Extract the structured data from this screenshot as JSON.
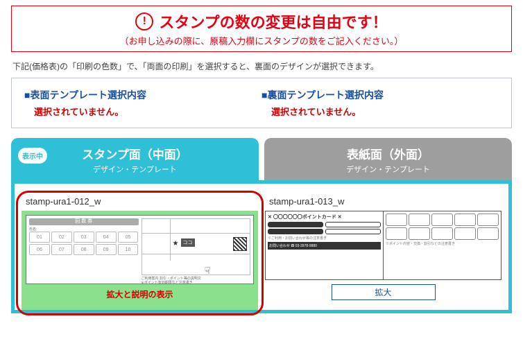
{
  "notice": {
    "title": "スタンプの数の変更は自由です！",
    "subtitle": "（お申し込みの際に、原稿入力欄にスタンプの数をご記入ください。）"
  },
  "description": "下記(価格表)の「印刷の色数」で、「両面の印刷」を選択すると、裏面のデザインが選択できます。",
  "selection": {
    "front": {
      "head": "■表面テンプレート選択内容",
      "body": "選択されていません。"
    },
    "back": {
      "head": "■裏面テンプレート選択内容",
      "body": "選択されていません。"
    }
  },
  "tabs": {
    "badge": "表示中",
    "active": {
      "title": "スタンプ面（中面）",
      "sub": "デザイン・テンプレート"
    },
    "inactive": {
      "title": "表紙面（外面）",
      "sub": "デザイン・テンプレート"
    }
  },
  "cards": [
    {
      "name": "stamp-ura1-012_w",
      "overlay": "拡大と説明の表示",
      "ticket_label": "回 数 券",
      "name_label": "氏名:"
    },
    {
      "name": "stamp-ura1-013_w",
      "zoom": "拡大",
      "point_label": "〇〇〇〇〇〇ポイントカード",
      "phone": "03-3978-9880"
    }
  ],
  "cells": [
    "01",
    "02",
    "03",
    "04",
    "05",
    "06",
    "07",
    "08",
    "09",
    "10"
  ],
  "map_marker": "ココ"
}
